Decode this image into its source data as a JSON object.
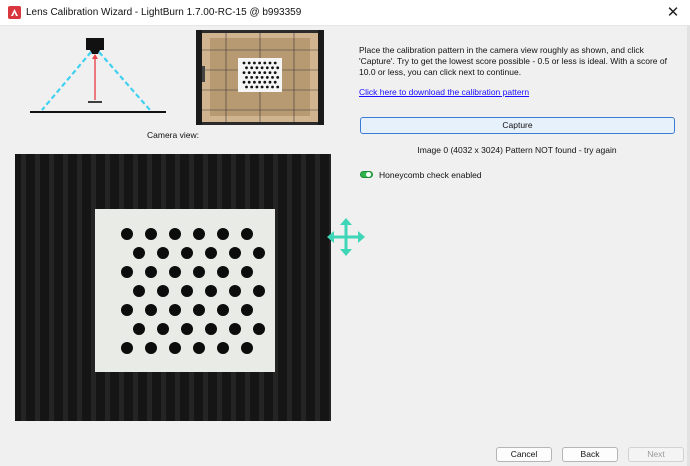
{
  "window": {
    "title": "Lens Calibration Wizard - LightBurn 1.7.00-RC-15 @ b993359",
    "close_glyph": "✕",
    "app_icon": "lightburn-logo-icon"
  },
  "colors": {
    "accent_blue": "#3a7bd5",
    "capture_bg": "#e7f1fb",
    "link": "#1a0dff",
    "toggle_on": "#2fb54a",
    "move_icon": "#3fd6b8",
    "beam_dash": "#40d0f0",
    "laser_line": "#e8474c"
  },
  "left": {
    "camera_label": "Camera view:"
  },
  "right": {
    "instructions": "Place the calibration pattern in the camera view roughly as shown, and click 'Capture'. Try to get the lowest score possible - 0.5 or less is ideal.  With a score of 10.0 or less, you can click next to continue.",
    "download_link": "Click here to download the calibration pattern",
    "capture_label": "Capture",
    "status": "Image 0 (4032 x 3024) Pattern NOT found - try again",
    "honeycomb_label": "Honeycomb check enabled",
    "honeycomb_enabled": true
  },
  "footer": {
    "cancel": "Cancel",
    "back": "Back",
    "next": "Next",
    "next_enabled": false
  }
}
